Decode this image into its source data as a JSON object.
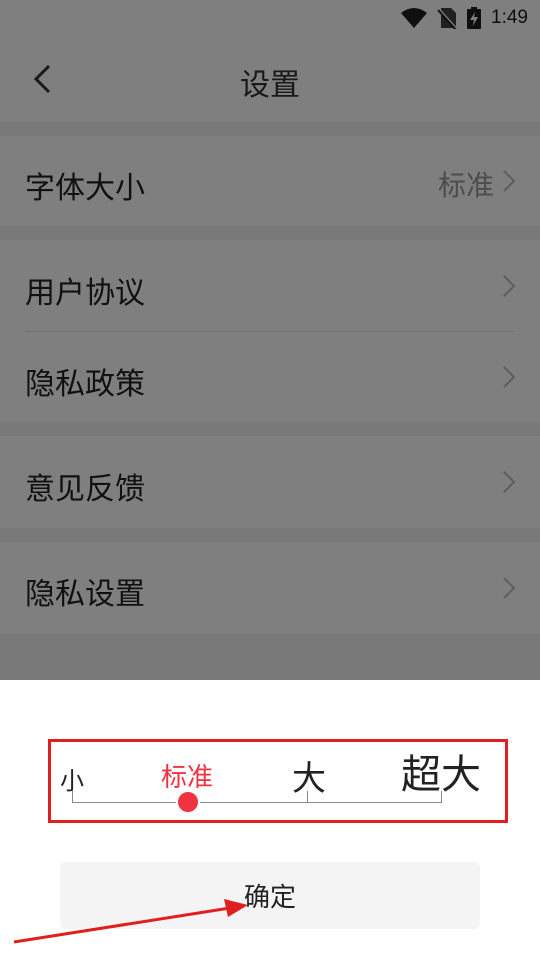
{
  "status_bar": {
    "time": "1:49",
    "icons": [
      "wifi-icon",
      "no-sim-icon",
      "battery-charging-icon"
    ]
  },
  "header": {
    "title": "设置",
    "back_icon": "chevron-left-icon"
  },
  "settings": {
    "font_size": {
      "label": "字体大小",
      "value": "标准"
    },
    "user_agreement": {
      "label": "用户协议"
    },
    "privacy_policy": {
      "label": "隐私政策"
    },
    "feedback": {
      "label": "意见反馈"
    },
    "privacy_settings": {
      "label": "隐私设置"
    }
  },
  "font_picker": {
    "options": [
      "小",
      "标准",
      "大",
      "超大"
    ],
    "selected": "标准",
    "selected_index": 1,
    "accent_color": "#ef3340",
    "confirm_label": "确定"
  },
  "annotation": {
    "highlight_color": "#e02020"
  }
}
